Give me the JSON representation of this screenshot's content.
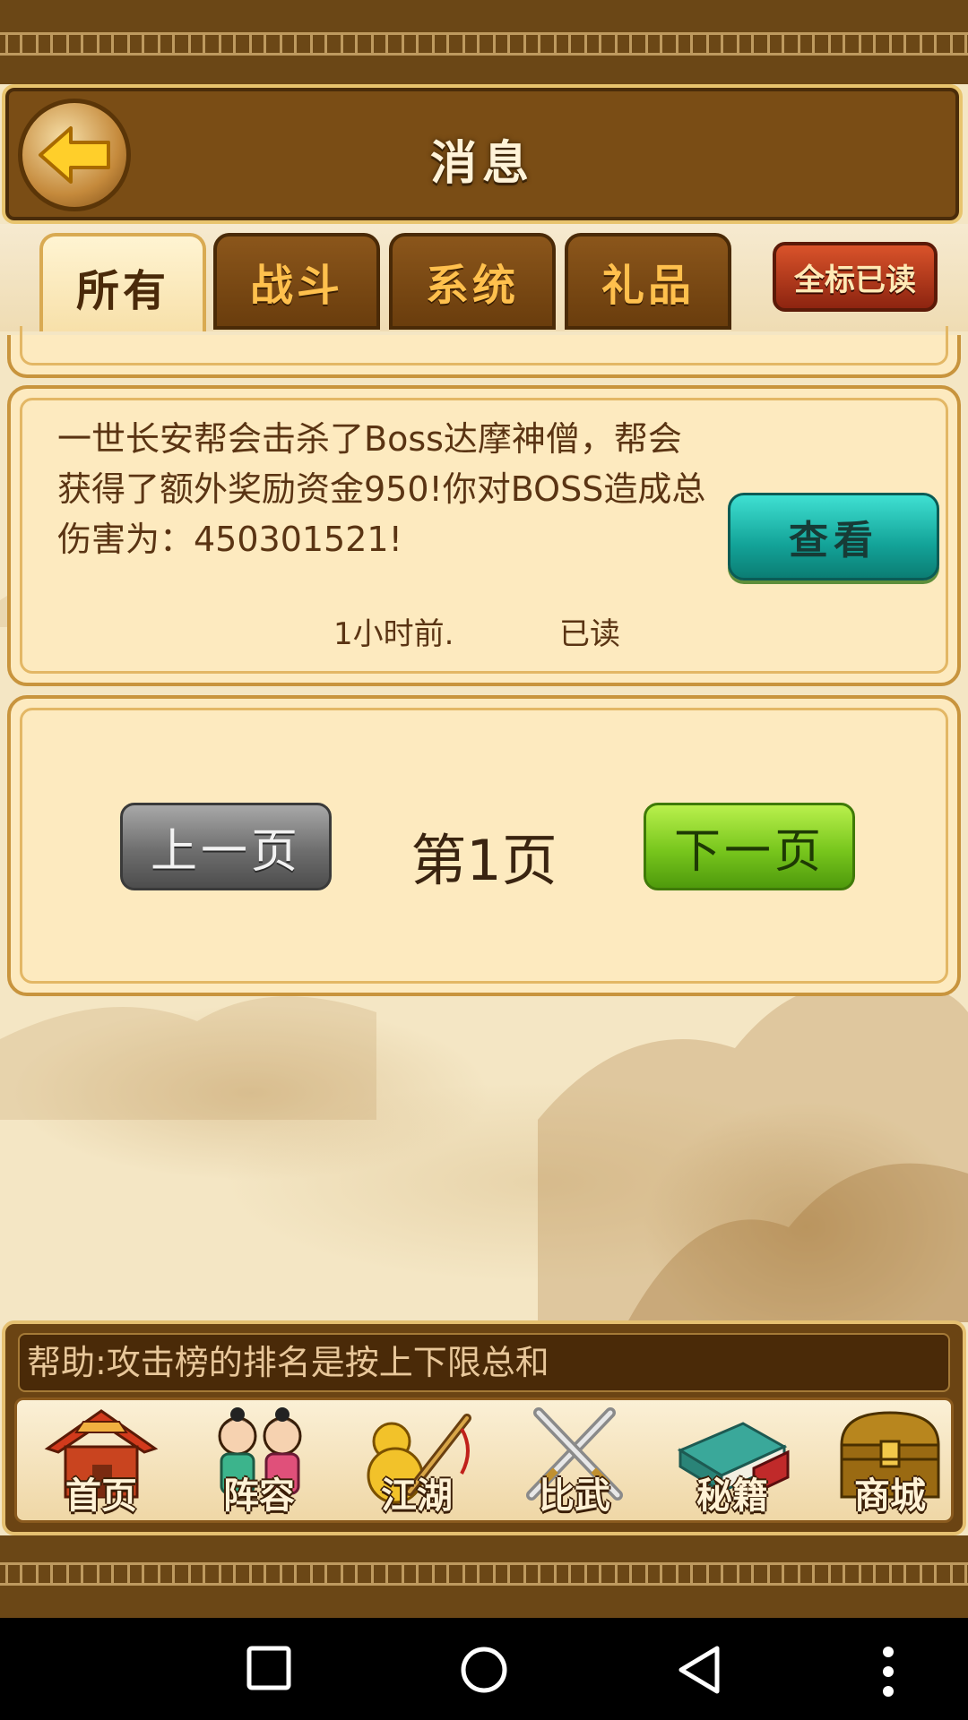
{
  "header": {
    "title": "消息",
    "back_icon": "back-arrow-icon"
  },
  "tabs": [
    {
      "label": "所有",
      "active": true
    },
    {
      "label": "战斗",
      "active": false
    },
    {
      "label": "系统",
      "active": false
    },
    {
      "label": "礼品",
      "active": false
    }
  ],
  "mark_all_read_label": "全标已读",
  "message": {
    "line1": "一世长安帮会击杀了Boss达摩神僧，帮会",
    "line2": "获得了额外奖励资金950!你对BOSS造成总",
    "line3": "伤害为：450301521!",
    "time": "1小时前.",
    "status": "已读",
    "view_label": "查看"
  },
  "pager": {
    "prev_label": "上一页",
    "page_label": "第1页",
    "next_label": "下一页"
  },
  "help": {
    "text": "帮助:攻击榜的排名是按上下限总和"
  },
  "nav": [
    {
      "label": "首页",
      "icon": "house-icon"
    },
    {
      "label": "阵容",
      "icon": "characters-icon"
    },
    {
      "label": "江湖",
      "icon": "gourd-sword-icon"
    },
    {
      "label": "比武",
      "icon": "crossed-swords-icon"
    },
    {
      "label": "秘籍",
      "icon": "books-icon"
    },
    {
      "label": "商城",
      "icon": "treasure-chest-icon"
    }
  ],
  "system_nav": [
    "recent-apps-icon",
    "home-circle-icon",
    "back-triangle-icon",
    "more-dots-icon"
  ],
  "colors": {
    "frame_brown": "#7a4d15",
    "gold_border": "#e8c46e",
    "parchment": "#fdeabf",
    "tab_text": "#ffc04d",
    "view_button": "#13a398",
    "next_button": "#78c61d",
    "prev_button": "#6e6e6e"
  }
}
